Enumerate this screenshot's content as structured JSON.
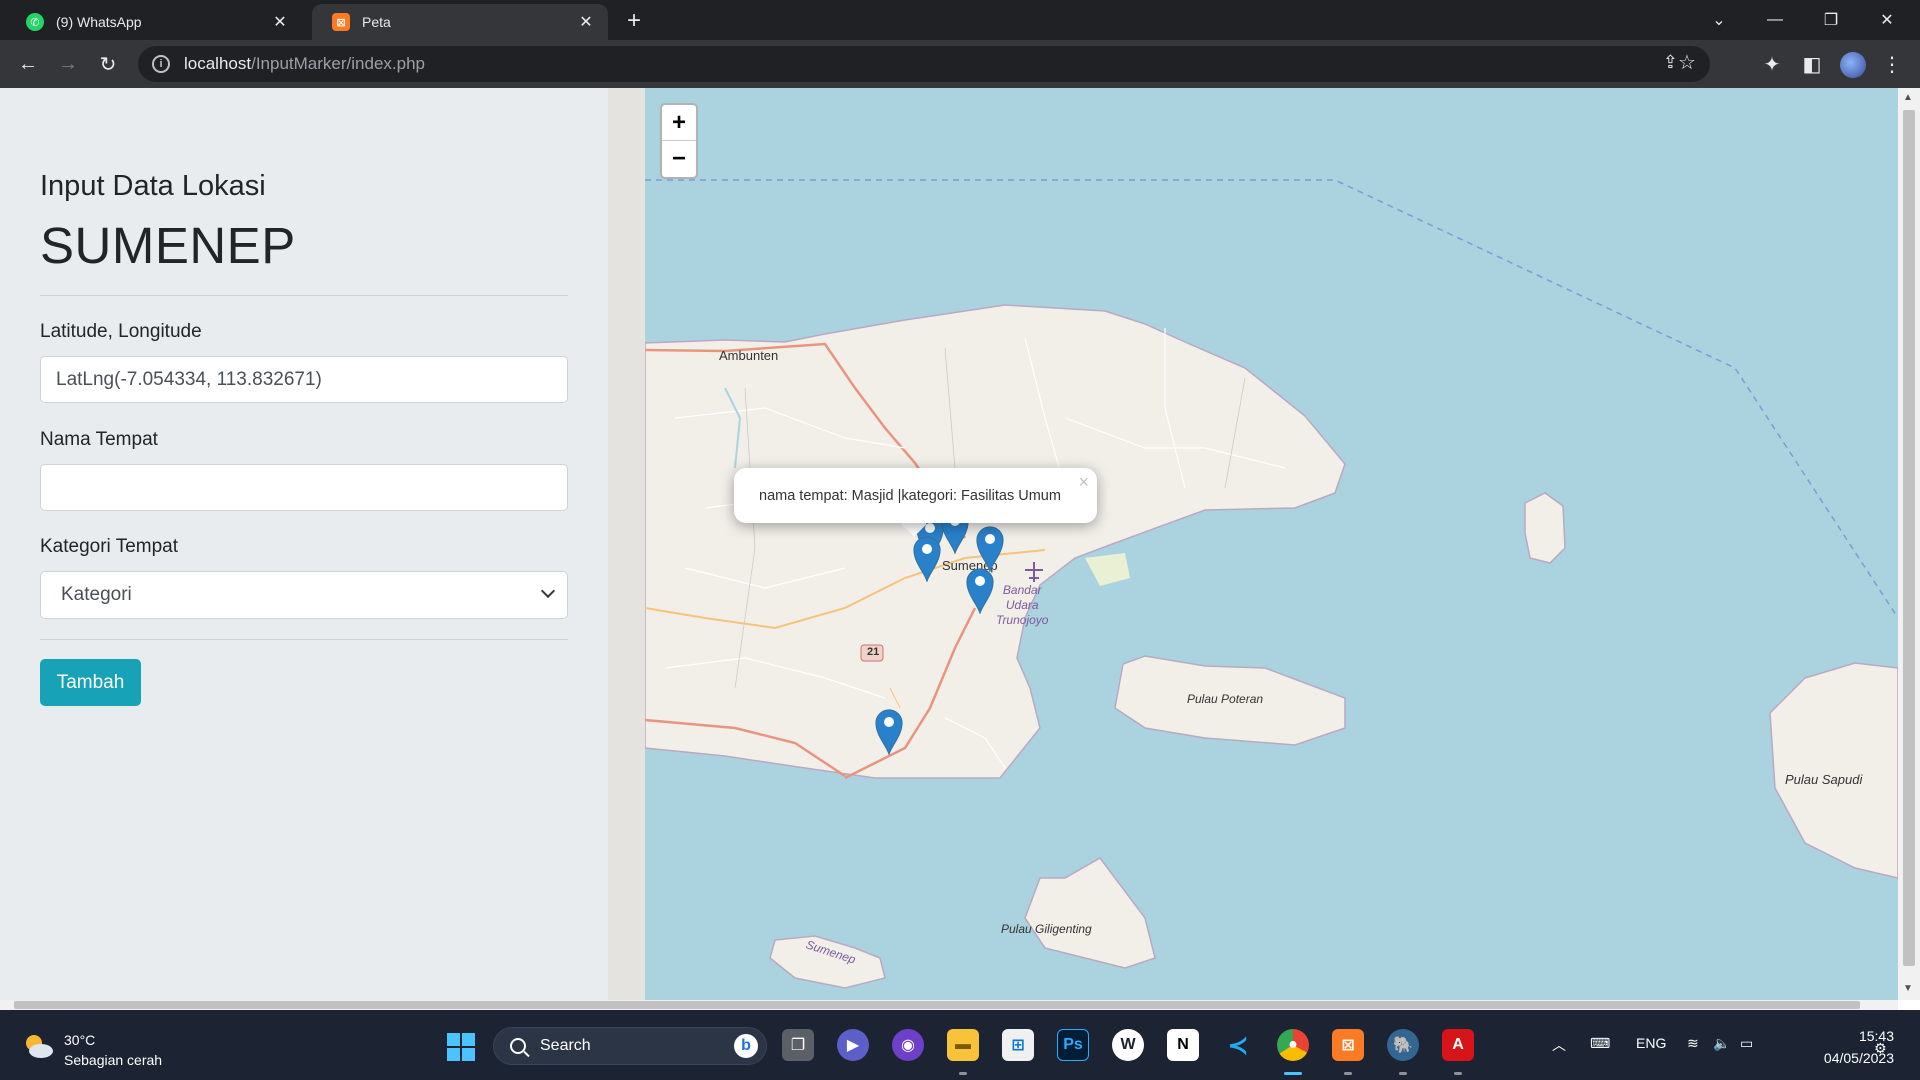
{
  "browser": {
    "tabs": [
      {
        "title": "(9) WhatsApp",
        "favicon": "whatsapp-icon",
        "active": false
      },
      {
        "title": "Peta",
        "favicon": "xampp-icon",
        "active": true
      }
    ],
    "url_host": "localhost",
    "url_path": "/InputMarker/index.php"
  },
  "form": {
    "heading": "Input Data Lokasi",
    "city": "SUMENEP",
    "latlng_label": "Latitude, Longitude",
    "latlng_value": "LatLng(-7.054334, 113.832671)",
    "name_label": "Nama Tempat",
    "name_value": "",
    "category_label": "Kategori Tempat",
    "category_selected": "Kategori",
    "submit_label": "Tambah"
  },
  "map": {
    "zoom_in": "+",
    "zoom_out": "−",
    "popup_text": "nama tempat: Masjid |kategori: Fasilitas Umum",
    "popup_close": "×",
    "labels": {
      "ambunten": "Ambunten",
      "sumenep": "Sumenep",
      "airport": "Bandar\nUdara\nTrunojoyo",
      "road": "21",
      "poteran": "Pulau Poteran",
      "sapudi": "Pulau Sapudi",
      "giligenting": "Pulau Giligenting",
      "sumenep_small": "Sumenep"
    },
    "colors": {
      "water": "#aad3df",
      "land": "#f2efe9",
      "marker": "#2a81cb"
    }
  },
  "taskbar": {
    "temperature": "30°C",
    "weather": "Sebagian cerah",
    "search_placeholder": "Search",
    "language": "ENG",
    "time": "15:43",
    "date": "04/05/2023"
  }
}
